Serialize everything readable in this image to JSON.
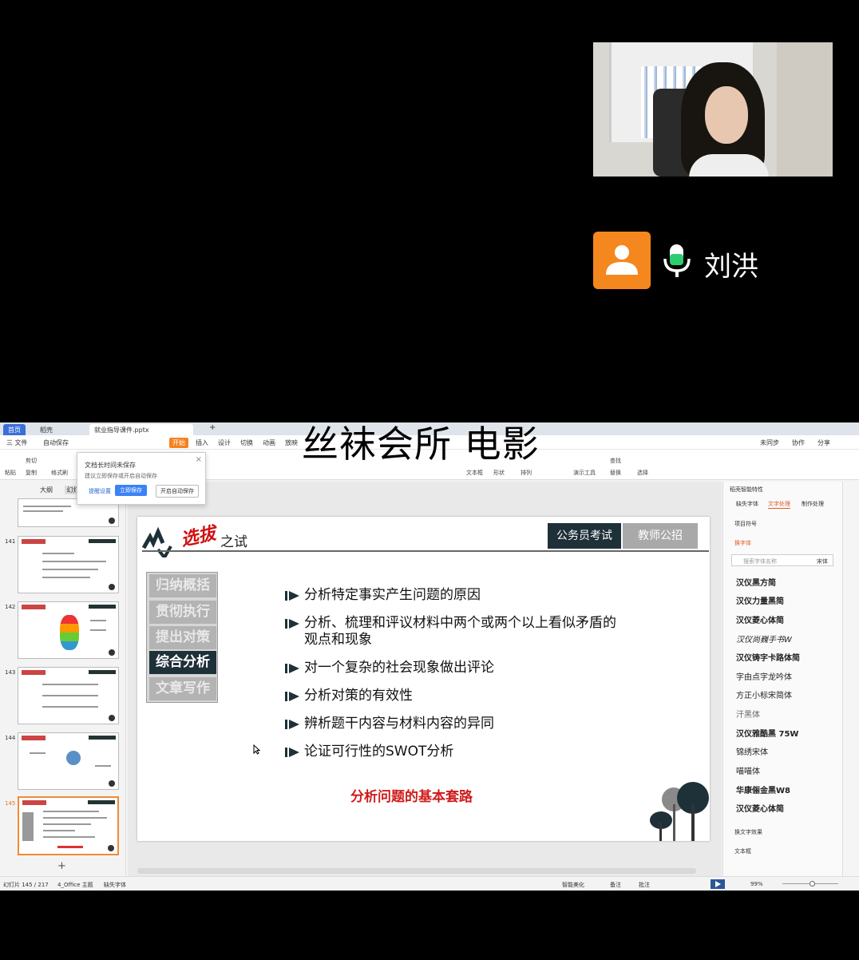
{
  "participant": {
    "name": "刘洪"
  },
  "watermark": "丝袜会所 电影",
  "tabs": [
    "首页",
    "稻壳",
    "就业指导课件.pptx"
  ],
  "menu": [
    "三 文件",
    "自动保存",
    "开始",
    "插入",
    "设计",
    "切换",
    "动画",
    "放映"
  ],
  "menu_right": [
    "未同步",
    "协作",
    "分享"
  ],
  "toolbar": [
    "粘贴",
    "剪切",
    "复制",
    "格式刷",
    "文本框",
    "形状",
    "排列",
    "演示工具",
    "查找",
    "替换",
    "选择"
  ],
  "popup": {
    "title": "文档长时间未保存",
    "desc": "建议立即保存或开启自动保存",
    "btn_settings": "提醒设置",
    "btn_save": "立即保存",
    "btn_auto": "开启自动保存"
  },
  "left_panel": {
    "tab_outline": "大纲",
    "tab_slides": "幻灯片",
    "add": "+"
  },
  "slide_numbers": [
    "141",
    "142",
    "143",
    "144",
    "145"
  ],
  "slide": {
    "logo_red": "选拔",
    "logo_black": "之试",
    "tab_active": "公务员考试",
    "tab_inactive": "教师公招",
    "nav": [
      "归纳概括",
      "贯彻执行",
      "提出对策",
      "综合分析",
      "文章写作"
    ],
    "bullets": [
      "分析特定事实产生问题的原因",
      "分析、梳理和评议材料中两个或两个以上看似矛盾的",
      "观点和现象",
      "对一个复杂的社会现象做出评论",
      "分析对策的有效性",
      "辨析题干内容与材料内容的异同",
      "论证可行性的SWOT分析"
    ],
    "caption": "分析问题的基本套路"
  },
  "right_panel": {
    "title": "稻壳智能特性",
    "tabs": [
      "缺失字体",
      "文字处理",
      "制作处理"
    ],
    "section1": "项目符号",
    "section2": "换字体",
    "search_placeholder": "搜索字体名称",
    "search_font": "宋体",
    "fonts": [
      "汉仪黑方简",
      "汉仪力量黑简",
      "汉仪菱心体简",
      "汉仪尚巍手书W",
      "汉仪铸字卡路体简",
      "字由点字龙吟体",
      "方正小标宋简体",
      "汗黑体",
      "汉仪雅酷黑 75W",
      "锦绣宋体",
      "喵喵体",
      "华康俪金黑W8",
      "汉仪菱心体简"
    ],
    "section3": "换文字效果",
    "section4": "文本框"
  },
  "status": {
    "slide": "幻灯片 145 / 217",
    "theme": "4_Office 主题",
    "missing": "缺失字体",
    "beautify": "智能美化",
    "notes": "备注",
    "comment": "批注",
    "zoom": "99%"
  }
}
